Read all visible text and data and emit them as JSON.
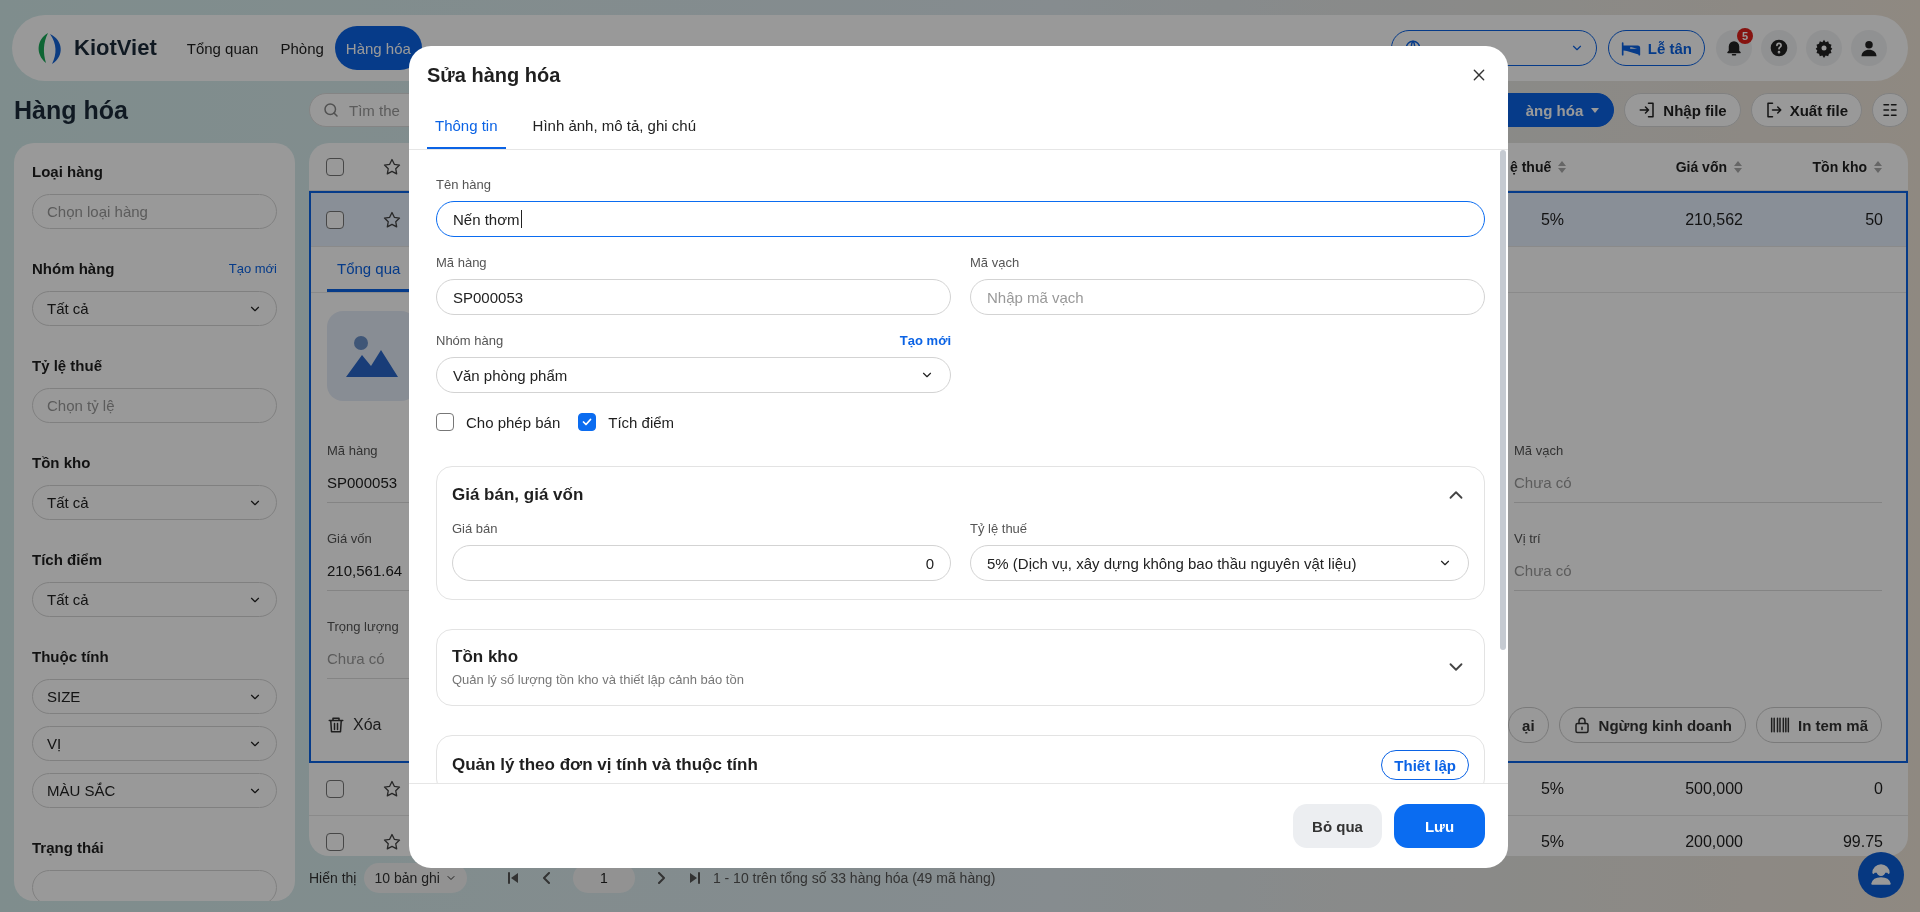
{
  "nav": {
    "brand": "KiotViet",
    "items": [
      {
        "label": "Tổng quan",
        "selected": false
      },
      {
        "label": "Phòng",
        "selected": false
      },
      {
        "label": "Hàng hóa",
        "selected": true
      }
    ],
    "reception_button": "Lễ tân",
    "notification_count": "5"
  },
  "toolbar": {
    "title": "Hàng hóa",
    "search_placeholder": "Tìm the",
    "add_button": "àng hóa",
    "import_button": "Nhập file",
    "export_button": "Xuất file"
  },
  "sidebar": {
    "filters": [
      {
        "label": "Loại hàng",
        "kind": "input",
        "placeholder": "Chọn loại hàng"
      },
      {
        "label": "Nhóm hàng",
        "link": "Tạo mới",
        "kind": "select",
        "values": [
          "Tất cả"
        ]
      },
      {
        "label": "Tỷ lệ thuế",
        "kind": "input",
        "placeholder": "Chọn tỷ lệ"
      },
      {
        "label": "Tồn kho",
        "kind": "select",
        "values": [
          "Tất cả"
        ]
      },
      {
        "label": "Tích điểm",
        "kind": "select",
        "values": [
          "Tất cả"
        ]
      },
      {
        "label": "Thuộc tính",
        "kind": "select",
        "values": [
          "SIZE",
          "VỊ",
          "MÀU SẮC"
        ]
      },
      {
        "label": "Trạng thái",
        "kind": "select"
      }
    ]
  },
  "table": {
    "all_checked": false,
    "columns": [
      {
        "label": "ệ thuế"
      },
      {
        "label": "Giá vốn"
      },
      {
        "label": "Tồn kho"
      }
    ],
    "rows": [
      {
        "selected": true,
        "checked": false,
        "starred": false,
        "cells": [
          "5%",
          "210,562",
          "50"
        ],
        "detail": {
          "tab": "Tổng qua",
          "left_fields": [
            {
              "label": "Mã hàng",
              "value": "SP000053"
            },
            {
              "label": "Giá vốn",
              "value": "210,561.64"
            },
            {
              "label": "Trọng lượng",
              "placeholder": "Chưa có"
            }
          ],
          "right_fields": [
            {
              "label": "Mã vạch",
              "placeholder": "Chưa có"
            },
            {
              "label": "Vị trí",
              "placeholder": "Chưa có"
            }
          ],
          "delete_button": "Xóa",
          "actions": [
            {
              "label": "ại",
              "kind": "plain"
            },
            {
              "label": "Ngừng kinh doanh",
              "kind": "lock"
            },
            {
              "label": "In tem mã",
              "kind": "barcode"
            }
          ]
        }
      },
      {
        "selected": false,
        "checked": false,
        "starred": false,
        "cells": [
          "5%",
          "500,000",
          "0"
        ]
      },
      {
        "selected": false,
        "checked": false,
        "starred": false,
        "cells": [
          "5%",
          "200,000",
          "99.75"
        ]
      }
    ]
  },
  "pager": {
    "label": "Hiển thị",
    "page_size": "10 bản ghi",
    "page": "1",
    "summary": "1 - 10 trên tổng số 33 hàng hóa (49 mã hàng)"
  },
  "modal": {
    "title": "Sửa hàng hóa",
    "tabs": [
      {
        "label": "Thông tin",
        "selected": true
      },
      {
        "label": "Hình ảnh, mô tả, ghi chú",
        "selected": false
      }
    ],
    "name": {
      "label": "Tên hàng",
      "value": "Nến thơm",
      "focused": true
    },
    "code": {
      "label": "Mã hàng",
      "value": "SP000053",
      "focused": false
    },
    "barcode": {
      "label": "Mã vạch",
      "placeholder": "Nhập mã vạch",
      "focused": false
    },
    "group": {
      "label": "Nhóm hàng",
      "link": "Tạo mới",
      "value": "Văn phòng phẩm",
      "kind": "select",
      "focused": false
    },
    "options": [
      {
        "label": "Cho phép bán",
        "checked": false
      },
      {
        "label": "Tích điểm",
        "checked": true
      }
    ],
    "sections": [
      {
        "title": "Giá bán, giá vốn",
        "expanded": true,
        "fields": [
          {
            "label": "Giá bán",
            "value": "0",
            "kind": "number",
            "focused": false
          },
          {
            "label": "Tỷ lệ thuế",
            "value": "5% (Dịch vụ, xây dựng không bao thầu nguyên vật liệu)",
            "kind": "select",
            "focused": false
          }
        ]
      },
      {
        "title": "Tồn kho",
        "subtitle": "Quản lý số lượng tồn kho và thiết lập cảnh báo tồn",
        "expanded": false
      },
      {
        "title": "Quản lý theo đơn vị tính và thuộc tính",
        "button": "Thiết lập"
      }
    ],
    "buttons": [
      {
        "label": "Bỏ qua",
        "kind": "secondary"
      },
      {
        "label": "Lưu",
        "kind": "primary"
      }
    ]
  }
}
